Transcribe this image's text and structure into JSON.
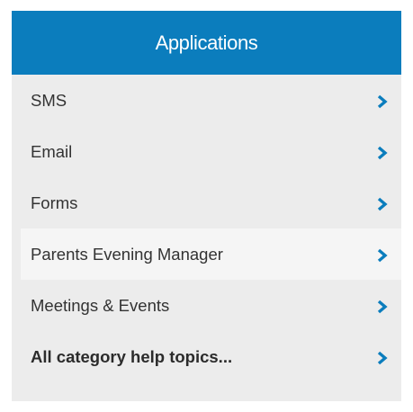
{
  "panel": {
    "title": "Applications",
    "header_color": "#0b7dbd",
    "chevron_color": "#0b7dbd",
    "items": [
      {
        "label": "SMS",
        "icon": "chevron-right-icon"
      },
      {
        "label": "Email",
        "icon": "chevron-right-icon"
      },
      {
        "label": "Forms",
        "icon": "chevron-right-icon"
      },
      {
        "label": "Parents Evening Manager",
        "icon": "chevron-right-icon",
        "highlighted": true
      },
      {
        "label": "Meetings & Events",
        "icon": "chevron-right-icon"
      },
      {
        "label": "All category help topics...",
        "icon": "chevron-right-icon",
        "bold": true
      }
    ]
  }
}
